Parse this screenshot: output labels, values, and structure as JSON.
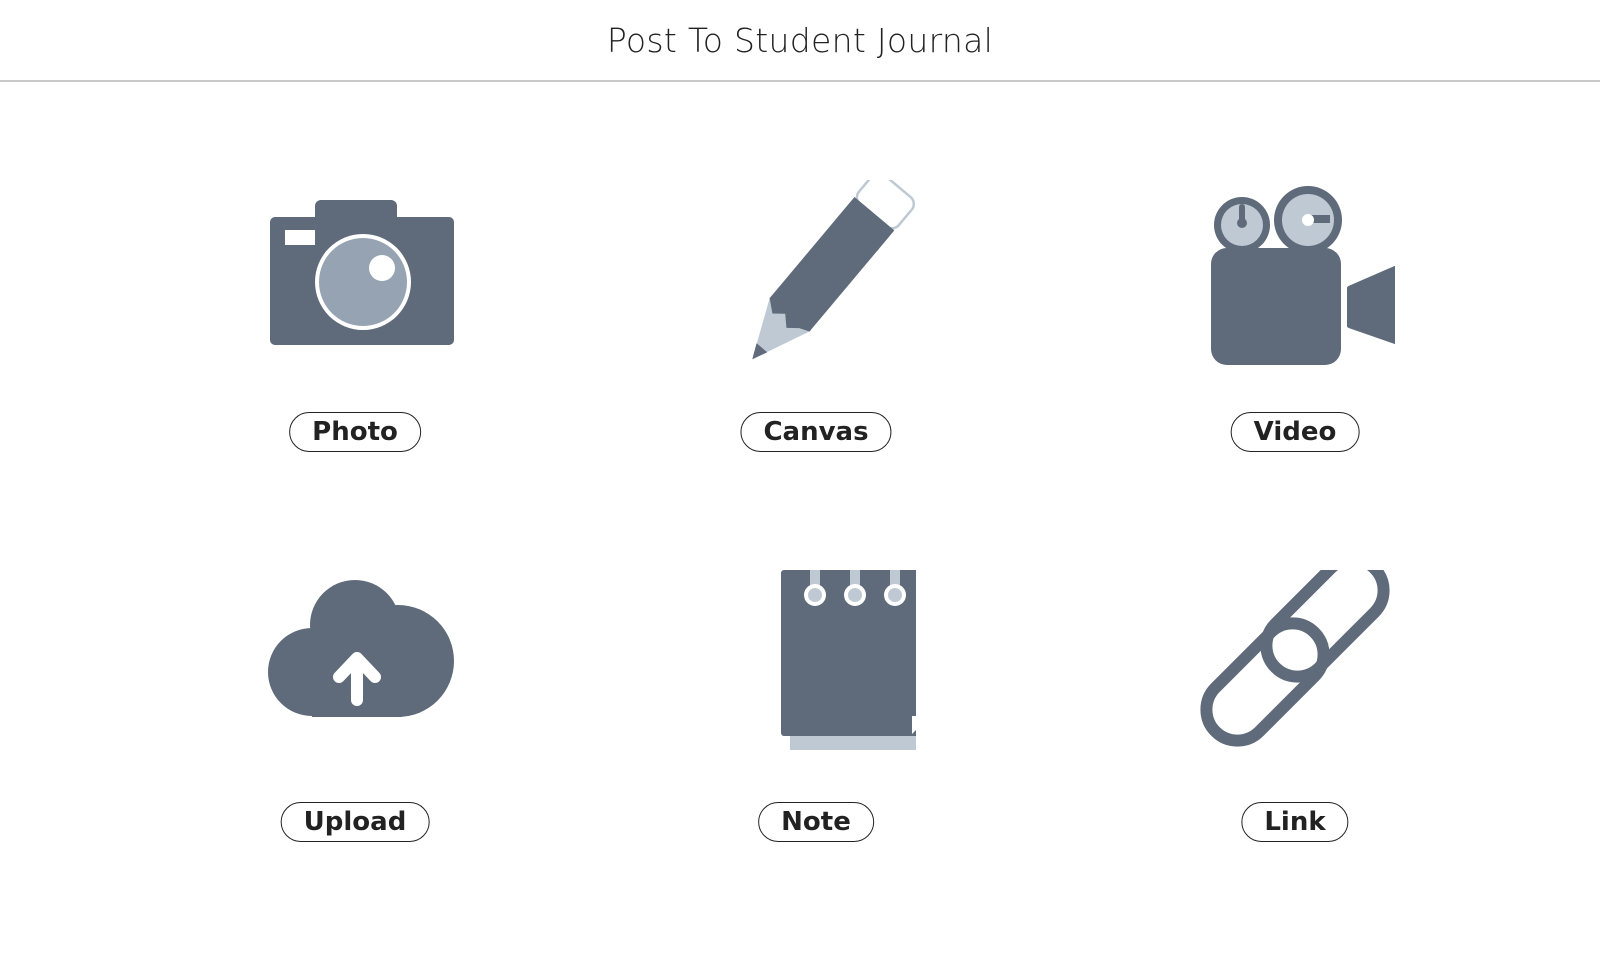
{
  "header": {
    "title": "Post To Student Journal"
  },
  "colors": {
    "icon_dark": "#5f6b7a",
    "icon_mid": "#96a3b2",
    "icon_light": "#bfc9d4",
    "pill_border": "#222222",
    "divider": "#c8c8c8"
  },
  "options": [
    {
      "label": "Photo",
      "icon": "camera-icon"
    },
    {
      "label": "Canvas",
      "icon": "pencil-icon"
    },
    {
      "label": "Video",
      "icon": "video-camera-icon"
    },
    {
      "label": "Upload",
      "icon": "cloud-upload-icon"
    },
    {
      "label": "Note",
      "icon": "notepad-icon"
    },
    {
      "label": "Link",
      "icon": "link-icon"
    }
  ]
}
